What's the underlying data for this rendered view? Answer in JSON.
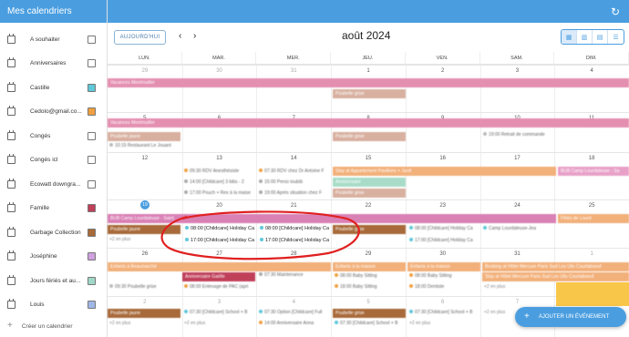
{
  "sidebar": {
    "title": "Mes calendriers",
    "items": [
      {
        "label": "A souhaiter",
        "color": "#ffffff"
      },
      {
        "label": "Anniversaires",
        "color": "#ffffff"
      },
      {
        "label": "Castille",
        "color": "#5ec8d8"
      },
      {
        "label": "Cedolo@gmail.co...",
        "color": "#f0a040"
      },
      {
        "label": "Congés",
        "color": "#ffffff"
      },
      {
        "label": "Congés icl",
        "color": "#ffffff"
      },
      {
        "label": "Ecowatt downgra...",
        "color": "#ffffff"
      },
      {
        "label": "Famille",
        "color": "#c0405a"
      },
      {
        "label": "Garbage Collection",
        "color": "#a86a3a"
      },
      {
        "label": "Joséphine",
        "color": "#d0a0e0"
      },
      {
        "label": "Jours fériés et au...",
        "color": "#a0d8c8"
      },
      {
        "label": "Louis",
        "color": "#a0b8e8"
      }
    ],
    "add_label": "Créer un calendrier"
  },
  "toolbar": {
    "today_label": "AUJOURD'HUI",
    "prev": "‹",
    "next": "›",
    "month_title": "août 2024",
    "refresh_icon": "↻"
  },
  "weekdays": [
    "LUN.",
    "MAR.",
    "MER.",
    "JEU.",
    "VEN.",
    "SAM.",
    "DIM."
  ],
  "weeks": [
    [
      "29",
      "30",
      "31",
      "1",
      "2",
      "3",
      "4"
    ],
    [
      "5",
      "6",
      "7",
      "8",
      "9",
      "10",
      "11"
    ],
    [
      "12",
      "13",
      "14",
      "15",
      "16",
      "17",
      "18"
    ],
    [
      "19",
      "20",
      "21",
      "22",
      "23",
      "24",
      "25"
    ],
    [
      "26",
      "27",
      "28",
      "29",
      "30",
      "31",
      "1"
    ],
    [
      "2",
      "3",
      "4",
      "5",
      "6",
      "7",
      "8"
    ]
  ],
  "events": {
    "w1_bar": "Vacances Montmuiller",
    "w1_sub": "Poubelle grise",
    "w2_bar": "Vacances Montmuiller",
    "w2_a": "Poubelle jaune",
    "w2_b": "10:15 Restaurant Le Jouant",
    "w2_c": "Poubelle grise",
    "w2_d": "19:00 Retrait de commande",
    "w3_a": "09:30 RDV Anesthésiste",
    "w3_b": "14:00 [Childcare] 3 bibs - 2",
    "w3_c": "17:00 Pouch + Rex à la maise",
    "w3_d": "07:30 RDV chez Dr Antoine F",
    "w3_e": "15:00 Perso toubib",
    "w3_f": "19:00 Après situation chez F",
    "w3_bar": "Stay at Appartement Pavillons + Jardi",
    "w3_g": "Anniversaire",
    "w3_h": "Poubelle grise",
    "w3_i": "BUB Camp Lourdaleuse - Sa",
    "w4_bar": "BUB Camp Lourdaleuse - Saint",
    "w4_a": "Poubelle jaune",
    "w4_b": "+2 en plus",
    "w4_c1": "08:00 [Childcare] Holiday Ca",
    "w4_c2": "17:00 [Childcare] Holiday Ca",
    "w4_c3": "08:00 [Childcare] Holiday Ca",
    "w4_c4": "17:00 [Childcare] Holiday Ca",
    "w4_d": "Poubelle grise",
    "w4_e": "08:00 [Childcare] Holiday Ca",
    "w4_f": "17:00 [Childcare] Holiday Ca",
    "w4_g": "Camp Lourdaleuse-Jea",
    "w4_h": "Fêtes de Lourd",
    "w5_bar": "Enfants à Beaumarché",
    "w5_a": "Anniversaire Gaëlle",
    "w5_b": "08:00 Enlevage de PAC (apri",
    "w5_c": "07:30 Maintenance",
    "w5_d": "Enfants à la maison",
    "w5_e": "08:00 Baby Sitting",
    "w5_f": "Enfants à la maison",
    "w5_g": "08:00 Baby Sitting",
    "w5_h": "Booking at Hôtel Mercure Paris Sud Les Ulis Courtaboeuf",
    "w5_i": "Stay at Hôtel Mercure Paris Sud Les Ulis Courtaboeuf",
    "w5_j": "+2 en plus",
    "w5_k": "09:30 Poubelle grise",
    "w5_l": "18:00 Baby Sitting",
    "w5_m": "18:00 Dentiste",
    "w6_a": "Poubelle jaune",
    "w6_b": "07:30 [Childcare] School + B",
    "w6_c": "+2 en plus",
    "w6_d": "07:30 Option [Childcare] Full",
    "w6_e": "14:00 Anniversaire Anna",
    "w6_f": "+2 en plus",
    "w6_g": "Poubelle grise",
    "w6_h": "07:30 [Childcare] School + B",
    "w6_i": "+2 en plus",
    "w6_j": "07:30 [Childcare] School + B",
    "w6_k": "+2 en plus"
  },
  "today": "19",
  "fab_label": "AJOUTER UN ÉVÉNEMENT",
  "fab_icon": "+",
  "colors": {
    "primary": "#4a9ee0",
    "pink": "#e07ba0",
    "peach": "#f2b07a",
    "brown": "#b06a40",
    "red_circle": "#e02020"
  }
}
